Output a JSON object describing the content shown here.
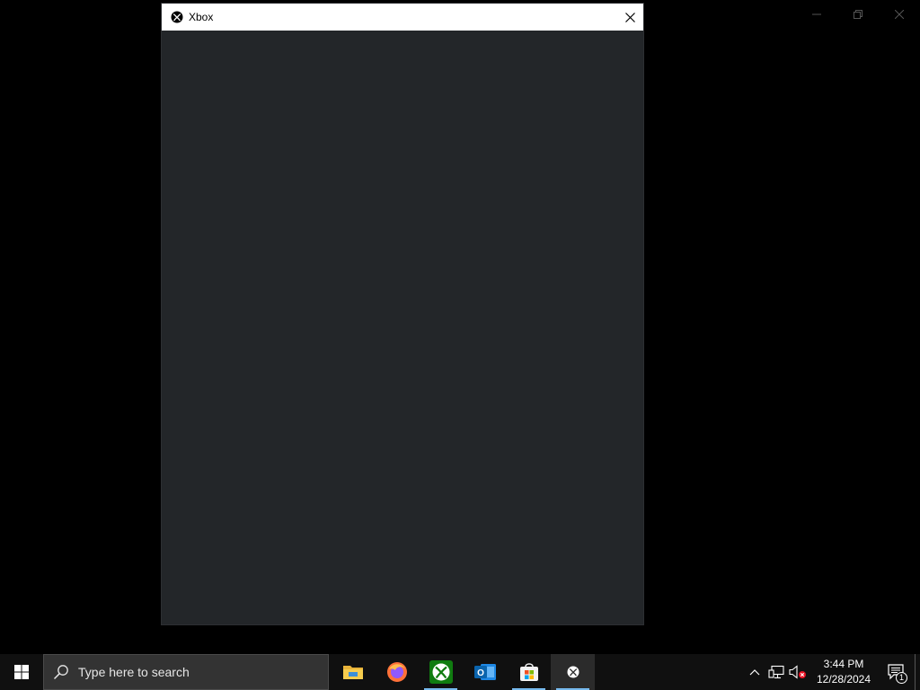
{
  "background_window": {
    "caption_buttons": [
      "minimize-icon",
      "restore-icon",
      "close-icon"
    ]
  },
  "xbox_window": {
    "title": "Xbox",
    "icon": "xbox-logo-icon",
    "close_icon": "close-icon",
    "content_bg": "#232629"
  },
  "taskbar": {
    "start_icon": "windows-logo-icon",
    "search": {
      "placeholder": "Type here to search",
      "icon": "search-icon"
    },
    "pinned_apps": [
      {
        "name": "File Explorer",
        "icon": "file-explorer-icon",
        "running": false
      },
      {
        "name": "Firefox",
        "icon": "firefox-icon",
        "running": false
      },
      {
        "name": "Xbox",
        "icon": "xbox-app-icon",
        "running": true
      },
      {
        "name": "Outlook",
        "icon": "outlook-icon",
        "running": false
      },
      {
        "name": "Microsoft Store",
        "icon": "store-icon",
        "running": true
      },
      {
        "name": "Xbox Game Bar",
        "icon": "xbox-small-icon",
        "running": true,
        "active": true
      }
    ],
    "tray": {
      "icons": [
        "chevron-up-icon",
        "network-icon",
        "volume-muted-icon"
      ],
      "time": "3:44 PM",
      "date": "12/28/2024",
      "notifications_count": "1"
    },
    "accent_color": "#76b9ed"
  }
}
